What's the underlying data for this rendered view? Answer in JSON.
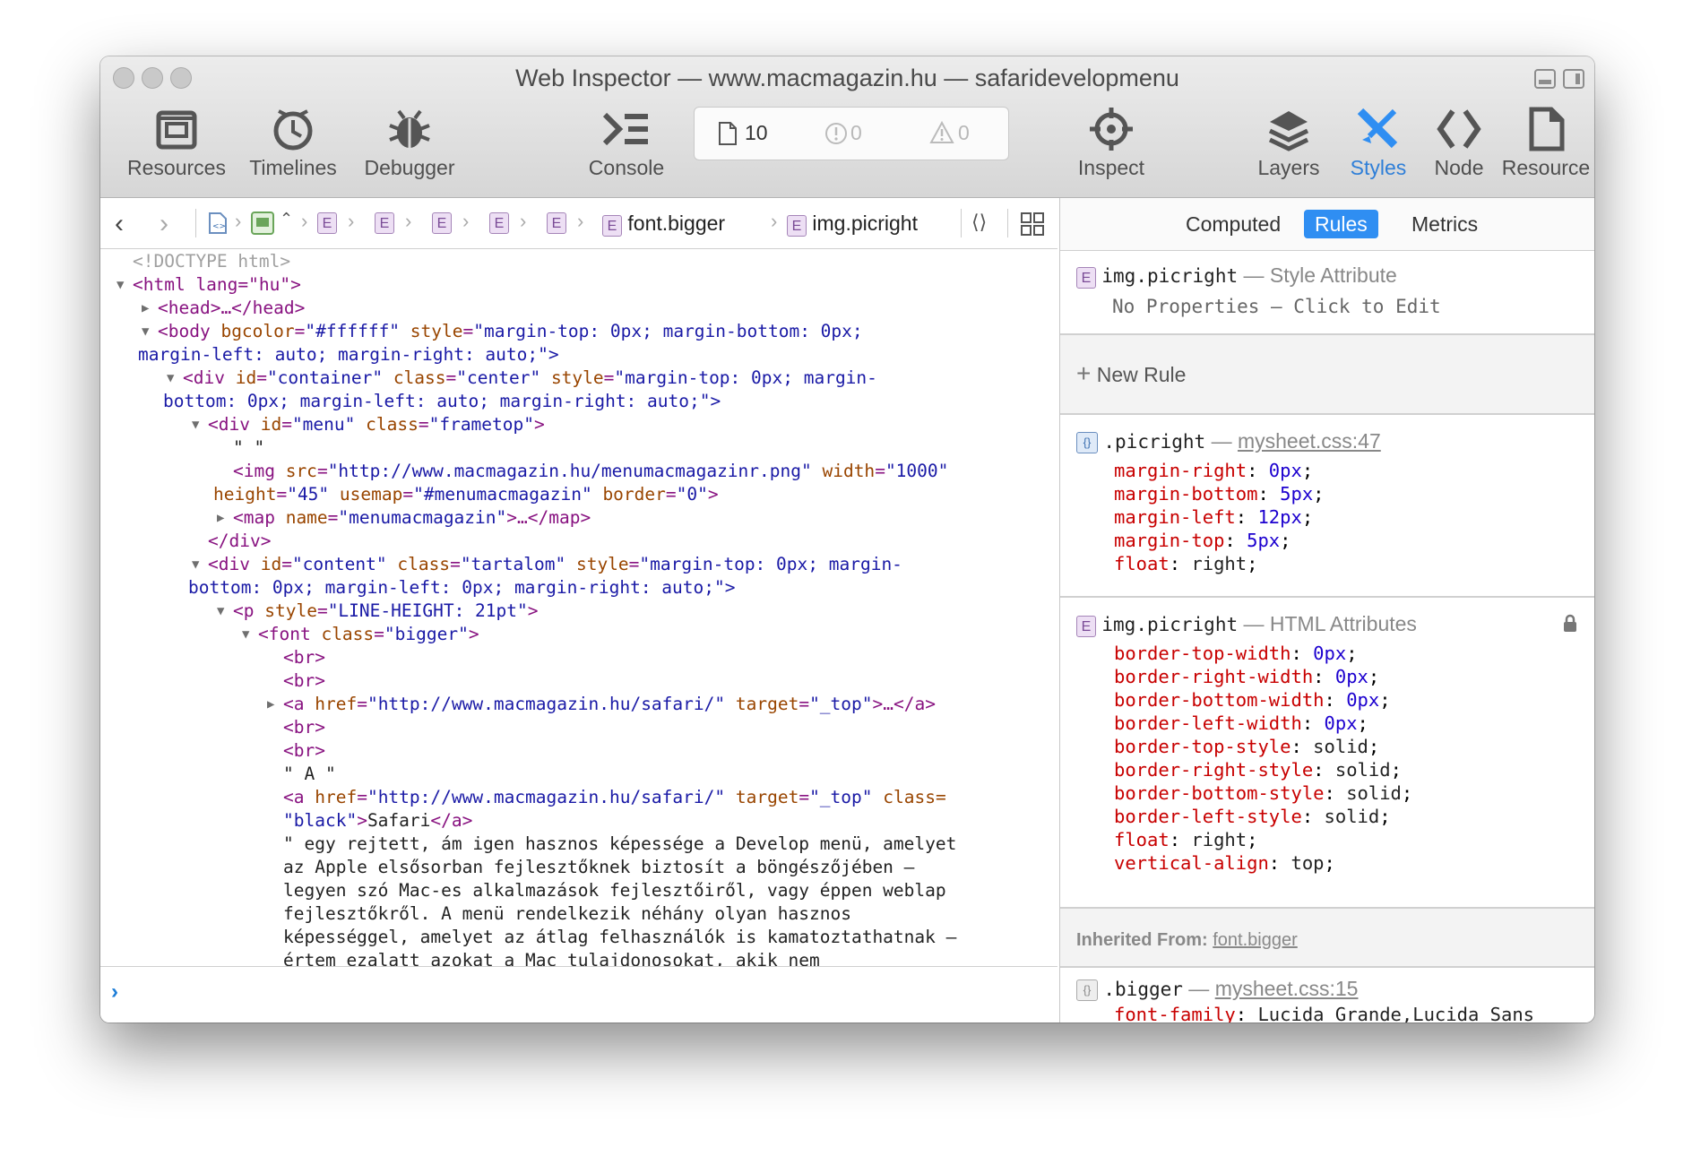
{
  "window": {
    "title": "Web Inspector — www.macmagazin.hu — safaridevelopmenu"
  },
  "toolbar": {
    "resources": "Resources",
    "timelines": "Timelines",
    "debugger": "Debugger",
    "console": "Console",
    "inspect": "Inspect",
    "layers": "Layers",
    "styles": "Styles",
    "node": "Node",
    "resource": "Resource",
    "dashboard": {
      "resources_count": "10",
      "errors_count": "0",
      "warnings_count": "0"
    }
  },
  "breadcrumb": {
    "e": "E",
    "font": "font.bigger",
    "img": "img.picright"
  },
  "dom": {
    "doctype": "<!DOCTYPE html>",
    "l1": "<html lang=\"hu\">",
    "head": "<head>…</head>",
    "body1": {
      "t": "<body ",
      "a1": "bgcolor",
      "v1": "\"#ffffff\"",
      "a2": " style",
      "v2": "\"margin-top: 0px; margin-bottom: 0px;"
    },
    "body2": "margin-left: auto; margin-right: auto;\">",
    "div1a": {
      "t": "<div ",
      "a1": "id",
      "v1": "\"container\"",
      "a2": " class",
      "v2": "\"center\"",
      "a3": " style",
      "v3": "\"margin-top: 0px; margin-"
    },
    "div1b": "bottom: 0px; margin-left: auto; margin-right: auto;\">",
    "div2": {
      "t": "<div ",
      "a1": "id",
      "v1": "\"menu\"",
      "a2": " class",
      "v2": "\"frametop\"",
      "e": ">"
    },
    "text1": "\" \"",
    "img1": {
      "t": "<img ",
      "a1": "src",
      "v1": "\"http://www.macmagazin.hu/menumacmagazinr.png\"",
      "a2": " width",
      "v2": "\"1000\""
    },
    "img2": {
      "a1": "height",
      "v1": "\"45\"",
      "a2": " usemap",
      "v2": "\"#menumacmagazin\"",
      "a3": " border",
      "v3": "\"0\"",
      "e": ">"
    },
    "map": {
      "t": "<map ",
      "a1": "name",
      "v1": "\"menumacmagazin\"",
      "e": ">…</map>"
    },
    "enddiv": "</div>",
    "div3a": {
      "t": "<div ",
      "a1": "id",
      "v1": "\"content\"",
      "a2": " class",
      "v2": "\"tartalom\"",
      "a3": " style",
      "v3": "\"margin-top: 0px; margin-"
    },
    "div3b": "bottom: 0px; margin-left: 0px; margin-right: auto;\">",
    "p": {
      "t": "<p ",
      "a1": "style",
      "v1": "\"LINE-HEIGHT: 21pt\"",
      "e": ">"
    },
    "font": {
      "t": "<font ",
      "a1": "class",
      "v1": "\"bigger\"",
      "e": ">"
    },
    "br": "<br>",
    "a1": {
      "t": "<a ",
      "a1": "href",
      "v1": "\"http://www.macmagazin.hu/safari/\"",
      "a2": " target",
      "v2": "\"_top\"",
      "e": ">…</a>"
    },
    "textA": "\" A \"",
    "a2": {
      "t": "<a ",
      "a1": "href",
      "v1": "\"http://www.macmagazin.hu/safari/\"",
      "a2": " target",
      "v2": "\"_top\"",
      "a3": " class="
    },
    "a2b": {
      "v": "\"black\"",
      "e": ">",
      "tx": "Safari",
      "c": "</a>"
    },
    "para": [
      "\" egy rejtett, ám igen hasznos képessége a Develop menü, amelyet",
      "az Apple elsősorban fejlesztőknek biztosít a böngészőjében –",
      "legyen szó Mac-es alkalmazások fejlesztőiről, vagy éppen weblap",
      "fejlesztőkről. A menü rendelkezik néhány olyan hasznos",
      "képességgel, amelyet az átlag felhasználók is kamatoztathatnak –",
      "értem ezalatt azokat a Mac tulajdonosokat, akik nem"
    ]
  },
  "console": {
    "prompt": "›"
  },
  "sidebar": {
    "tabs": {
      "computed": "Computed",
      "rules": "Rules",
      "metrics": "Metrics"
    },
    "style_attr": {
      "selector": "img.picright",
      "dash": " — ",
      "origin": "Style Attribute",
      "empty": "No Properties — Click to Edit"
    },
    "new_rule": "New Rule",
    "rule1": {
      "selector": ".picright",
      "dash": " — ",
      "source": "mysheet.css:47",
      "props": [
        {
          "n": "margin-right",
          "v": "0px"
        },
        {
          "n": "margin-bottom",
          "v": "5px"
        },
        {
          "n": "margin-left",
          "v": "12px"
        },
        {
          "n": "margin-top",
          "v": "5px"
        },
        {
          "n": "float",
          "v": "right"
        }
      ]
    },
    "rule2": {
      "selector": "img.picright",
      "dash": " — ",
      "origin": "HTML Attributes",
      "props": [
        {
          "n": "border-top-width",
          "v": "0px"
        },
        {
          "n": "border-right-width",
          "v": "0px"
        },
        {
          "n": "border-bottom-width",
          "v": "0px"
        },
        {
          "n": "border-left-width",
          "v": "0px"
        },
        {
          "n": "border-top-style",
          "v": "solid"
        },
        {
          "n": "border-right-style",
          "v": "solid"
        },
        {
          "n": "border-bottom-style",
          "v": "solid"
        },
        {
          "n": "border-left-style",
          "v": "solid"
        },
        {
          "n": "float",
          "v": "right"
        },
        {
          "n": "vertical-align",
          "v": "top"
        }
      ]
    },
    "inherited": {
      "label": "Inherited From: ",
      "link": "font.bigger"
    },
    "rule3": {
      "selector": ".bigger",
      "dash": " — ",
      "source": "mysheet.css:15",
      "prop": "font-family",
      "val": "Lucida Grande,Lucida Sans"
    }
  },
  "colors": {
    "accent": "#2f8ef2",
    "tag": "#881280",
    "attr_name": "#994500",
    "attr_value": "#1a1aa6",
    "css_prop": "#c80000"
  }
}
